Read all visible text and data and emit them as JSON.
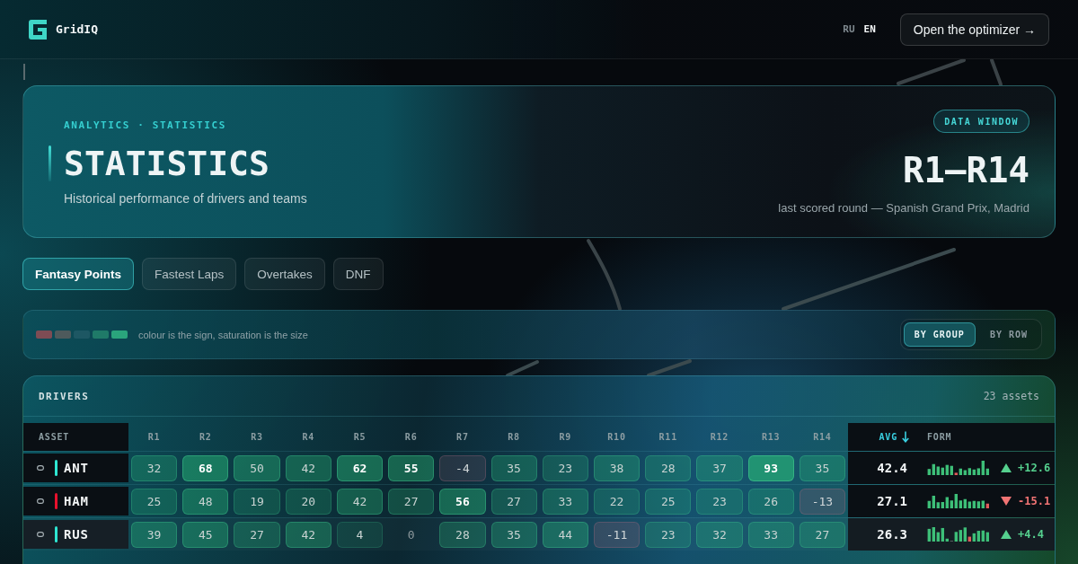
{
  "header": {
    "brand": "GridIQ",
    "languages": [
      {
        "label": "RU",
        "selected": false
      },
      {
        "label": "EN",
        "selected": true
      }
    ],
    "cta": "Open the optimizer →"
  },
  "hero": {
    "eyebrow": "ANALYTICS · STATISTICS",
    "title": "STATISTICS",
    "subtitle": "Historical performance of drivers and teams",
    "badge": "DATA WINDOW",
    "range": "R1—R14",
    "note": "last scored round — Spanish Grand Prix, Madrid"
  },
  "tabs": [
    {
      "label": "Fantasy Points",
      "selected": true
    },
    {
      "label": "Fastest Laps",
      "selected": false
    },
    {
      "label": "Overtakes",
      "selected": false
    },
    {
      "label": "DNF",
      "selected": false
    }
  ],
  "legend": {
    "swatches": [
      {
        "color": "#7e4c54"
      },
      {
        "color": "#4e5a5c"
      },
      {
        "color": "#1d5763"
      },
      {
        "color": "#1f7a68"
      },
      {
        "color": "#2aa57c"
      }
    ],
    "caption": "colour is the sign, saturation is the size",
    "modes": [
      {
        "label": "BY GROUP",
        "selected": true
      },
      {
        "label": "BY ROW",
        "selected": false
      }
    ]
  },
  "table": {
    "title": "DRIVERS",
    "count": "23 assets",
    "columns": [
      {
        "label": "ASSET",
        "kind": "asset",
        "sorted": false
      },
      {
        "label": "R1",
        "kind": "round",
        "sorted": false
      },
      {
        "label": "R2",
        "kind": "round",
        "sorted": false
      },
      {
        "label": "R3",
        "kind": "round",
        "sorted": false
      },
      {
        "label": "R4",
        "kind": "round",
        "sorted": false
      },
      {
        "label": "R5",
        "kind": "round",
        "sorted": false
      },
      {
        "label": "R6",
        "kind": "round",
        "sorted": false
      },
      {
        "label": "R7",
        "kind": "round",
        "sorted": false
      },
      {
        "label": "R8",
        "kind": "round",
        "sorted": false
      },
      {
        "label": "R9",
        "kind": "round",
        "sorted": false
      },
      {
        "label": "R10",
        "kind": "round",
        "sorted": false
      },
      {
        "label": "R11",
        "kind": "round",
        "sorted": false
      },
      {
        "label": "R12",
        "kind": "round",
        "sorted": false
      },
      {
        "label": "R13",
        "kind": "round",
        "sorted": false
      },
      {
        "label": "R14",
        "kind": "round",
        "sorted": false
      },
      {
        "label": "AVG",
        "kind": "avg",
        "sorted": true
      },
      {
        "label": "FORM",
        "kind": "form",
        "sorted": false
      }
    ],
    "rows": [
      {
        "name": "ANT",
        "color": "#2ee6d2",
        "selected": false,
        "values": [
          "32",
          "68",
          "50",
          "42",
          "62",
          "55",
          "-4",
          "35",
          "23",
          "38",
          "28",
          "37",
          "93",
          "35"
        ],
        "avg": "42.4",
        "trend": {
          "rising": true,
          "text": "+12.6"
        }
      },
      {
        "name": "HAM",
        "color": "#e8112d",
        "selected": false,
        "values": [
          "25",
          "48",
          "19",
          "20",
          "42",
          "27",
          "56",
          "27",
          "33",
          "22",
          "25",
          "23",
          "26",
          "-13"
        ],
        "avg": "27.1",
        "trend": {
          "rising": false,
          "text": "-15.1"
        }
      },
      {
        "name": "RUS",
        "color": "#2ee6d2",
        "selected": true,
        "values": [
          "39",
          "45",
          "27",
          "42",
          "4",
          "0",
          "28",
          "35",
          "44",
          "-11",
          "23",
          "32",
          "33",
          "27"
        ],
        "avg": "26.3",
        "trend": {
          "rising": true,
          "text": "+4.4"
        }
      }
    ]
  }
}
